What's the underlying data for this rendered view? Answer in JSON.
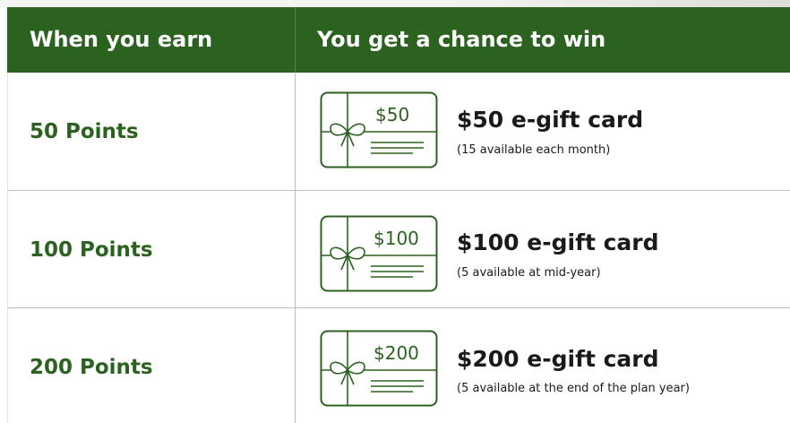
{
  "header": {
    "col1": "When you earn",
    "col2": "You get a chance to win"
  },
  "rows": [
    {
      "points": "50 Points",
      "card_amount": "$50",
      "title": "$50 e-gift card",
      "subtitle": "(15 available each month)"
    },
    {
      "points": "100 Points",
      "card_amount": "$100",
      "title": "$100 e-gift card",
      "subtitle": "(5 available at mid-year)"
    },
    {
      "points": "200 Points",
      "card_amount": "$200",
      "title": "$200 e-gift card",
      "subtitle": "(5 available at the end of the plan year)"
    }
  ],
  "colors": {
    "brand_green": "#2c6220",
    "text": "#1a1a1a",
    "divider": "#bdbdbd"
  },
  "icons": [
    "gift-card-icon"
  ]
}
